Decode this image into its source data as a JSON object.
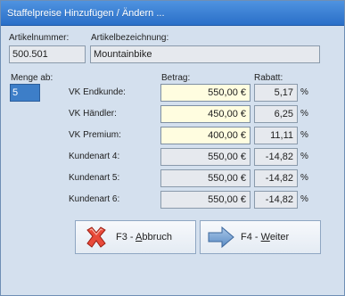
{
  "window": {
    "title": "Staffelpreise Hinzufügen / Ändern ..."
  },
  "header": {
    "artikelnummer_label": "Artikelnummer:",
    "artikelnummer_value": "500.501",
    "bezeichnung_label": "Artikelbezeichnung:",
    "bezeichnung_value": "Mountainbike"
  },
  "menge": {
    "label": "Menge ab:",
    "value": "5"
  },
  "columns": {
    "betrag": "Betrag:",
    "rabatt": "Rabatt:"
  },
  "rows": [
    {
      "label": "VK Endkunde:",
      "betrag": "550,00 €",
      "rabatt": "5,17",
      "unit": "%",
      "editable": true
    },
    {
      "label": "VK Händler:",
      "betrag": "450,00 €",
      "rabatt": "6,25",
      "unit": "%",
      "editable": true
    },
    {
      "label": "VK Premium:",
      "betrag": "400,00 €",
      "rabatt": "11,11",
      "unit": "%",
      "editable": true
    },
    {
      "label": "Kundenart 4:",
      "betrag": "550,00 €",
      "rabatt": "-14,82",
      "unit": "%",
      "editable": false
    },
    {
      "label": "Kundenart 5:",
      "betrag": "550,00 €",
      "rabatt": "-14,82",
      "unit": "%",
      "editable": false
    },
    {
      "label": "Kundenart 6:",
      "betrag": "550,00 €",
      "rabatt": "-14,82",
      "unit": "%",
      "editable": false
    }
  ],
  "buttons": {
    "abbruch": {
      "prefix": "F3 - ",
      "accel": "A",
      "rest": "bbruch",
      "icon": "red-x-icon"
    },
    "weiter": {
      "prefix": "F4 - ",
      "accel": "W",
      "rest": "eiter",
      "icon": "right-arrow-icon"
    }
  },
  "colors": {
    "editable_bg": "#fffde0",
    "selected_bg": "#3d7ec8",
    "title_bar": "#3a80d6"
  }
}
